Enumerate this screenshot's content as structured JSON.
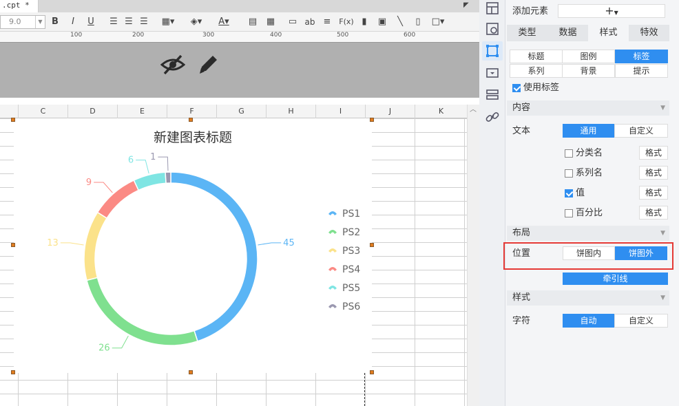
{
  "tab": {
    "filename": ".cpt *"
  },
  "toolbar": {
    "font_size": "9.0",
    "bold": "B",
    "italic": "I",
    "underline": "U",
    "text_ab": "ab",
    "formula": "F(x)"
  },
  "ruler": {
    "ticks": [
      "100",
      "200",
      "300",
      "400",
      "500",
      "600"
    ]
  },
  "columns": [
    "C",
    "D",
    "E",
    "F",
    "G",
    "H",
    "I",
    "J",
    "K"
  ],
  "chart_data": {
    "type": "pie",
    "title": "新建图表标题",
    "series": [
      {
        "name": "PS1",
        "value": 45,
        "color": "#5bb5f5"
      },
      {
        "name": "PS2",
        "value": 26,
        "color": "#7fe08f"
      },
      {
        "name": "PS3",
        "value": 13,
        "color": "#fbe28a"
      },
      {
        "name": "PS4",
        "value": 9,
        "color": "#fb8a84"
      },
      {
        "name": "PS5",
        "value": 6,
        "color": "#7fe5e3"
      },
      {
        "name": "PS6",
        "value": 1,
        "color": "#9a98b0"
      }
    ],
    "legend_position": "right",
    "donut": true
  },
  "panel": {
    "add_element_label": "添加元素",
    "add_symbol": "+",
    "tabs": [
      "类型",
      "数据",
      "样式",
      "特效"
    ],
    "active_tab": "样式",
    "subtabs_row1": [
      "标题",
      "图例",
      "标签"
    ],
    "subtabs_row2": [
      "系列",
      "背景",
      "提示"
    ],
    "active_subtab": "标签",
    "use_label": "使用标签",
    "section_content": "内容",
    "text_label": "文本",
    "text_opt_general": "通用",
    "text_opt_custom": "自定义",
    "options": [
      {
        "label": "分类名",
        "checked": false,
        "format": "格式"
      },
      {
        "label": "系列名",
        "checked": false,
        "format": "格式"
      },
      {
        "label": "值",
        "checked": true,
        "format": "格式"
      },
      {
        "label": "百分比",
        "checked": false,
        "format": "格式"
      }
    ],
    "section_layout": "布局",
    "position_label": "位置",
    "pos_inside": "饼图内",
    "pos_outside": "饼图外",
    "leader_line": "牵引线",
    "section_style": "样式",
    "char_label": "字符",
    "char_auto": "自动",
    "char_custom": "自定义"
  },
  "colors": {
    "accent": "#2f8ef0",
    "highlight": "#e53935",
    "handle": "#e07c1f"
  }
}
